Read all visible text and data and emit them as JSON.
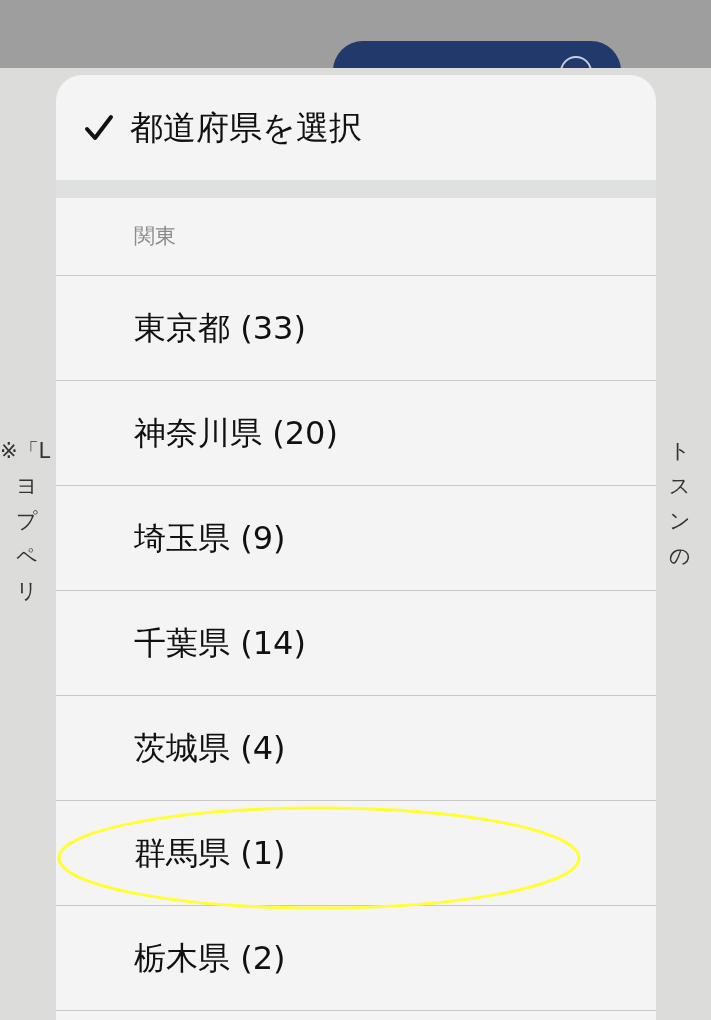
{
  "background": {
    "note_left": [
      "※「L",
      "ヨ",
      "プ",
      "ペ",
      "リ"
    ],
    "note_right": [
      "ト",
      "ス",
      "ン",
      "の"
    ]
  },
  "picker": {
    "header": {
      "label": "都道府県を選択",
      "checked": true
    },
    "group": "関東",
    "options": [
      {
        "label": "東京都 (33)",
        "selected": false,
        "circled": false
      },
      {
        "label": "神奈川県 (20)",
        "selected": false,
        "circled": false
      },
      {
        "label": "埼玉県 (9)",
        "selected": false,
        "circled": false
      },
      {
        "label": "千葉県 (14)",
        "selected": false,
        "circled": false
      },
      {
        "label": "茨城県 (4)",
        "selected": false,
        "circled": false
      },
      {
        "label": "群馬県 (1)",
        "selected": false,
        "circled": true
      },
      {
        "label": "栃木県 (2)",
        "selected": false,
        "circled": false
      }
    ]
  }
}
